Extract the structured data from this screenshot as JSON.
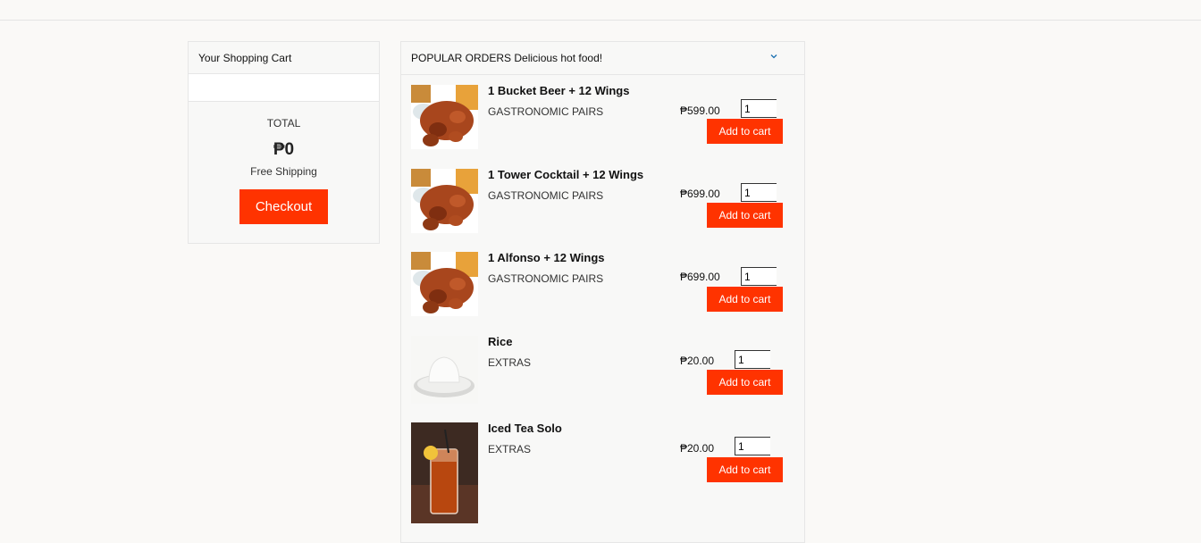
{
  "cart": {
    "title": "Your Shopping Cart",
    "total_label": "TOTAL",
    "total_value": "₱0",
    "shipping": "Free Shipping",
    "checkout_label": "Checkout"
  },
  "orders": {
    "title": "POPULAR ORDERS Delicious hot food!",
    "add_label": "Add to cart",
    "items": [
      {
        "name": "1 Bucket Beer + 12 Wings",
        "category": "GASTRONOMIC PAIRS",
        "price": "₱599.00",
        "qty": "1",
        "image": "wings-image"
      },
      {
        "name": "1 Tower Cocktail + 12 Wings",
        "category": "GASTRONOMIC PAIRS",
        "price": "₱699.00",
        "qty": "1",
        "image": "wings-image"
      },
      {
        "name": "1 Alfonso + 12 Wings",
        "category": "GASTRONOMIC PAIRS",
        "price": "₱699.00",
        "qty": "1",
        "image": "wings-image"
      },
      {
        "name": "Rice",
        "category": "EXTRAS",
        "price": "₱20.00",
        "qty": "1",
        "image": "rice-image"
      },
      {
        "name": "Iced Tea Solo",
        "category": "EXTRAS",
        "price": "₱20.00",
        "qty": "1",
        "image": "iced-tea-image"
      }
    ]
  },
  "colors": {
    "accent": "#ff3300",
    "background": "#faf9f7",
    "border": "#e6e6e6"
  }
}
